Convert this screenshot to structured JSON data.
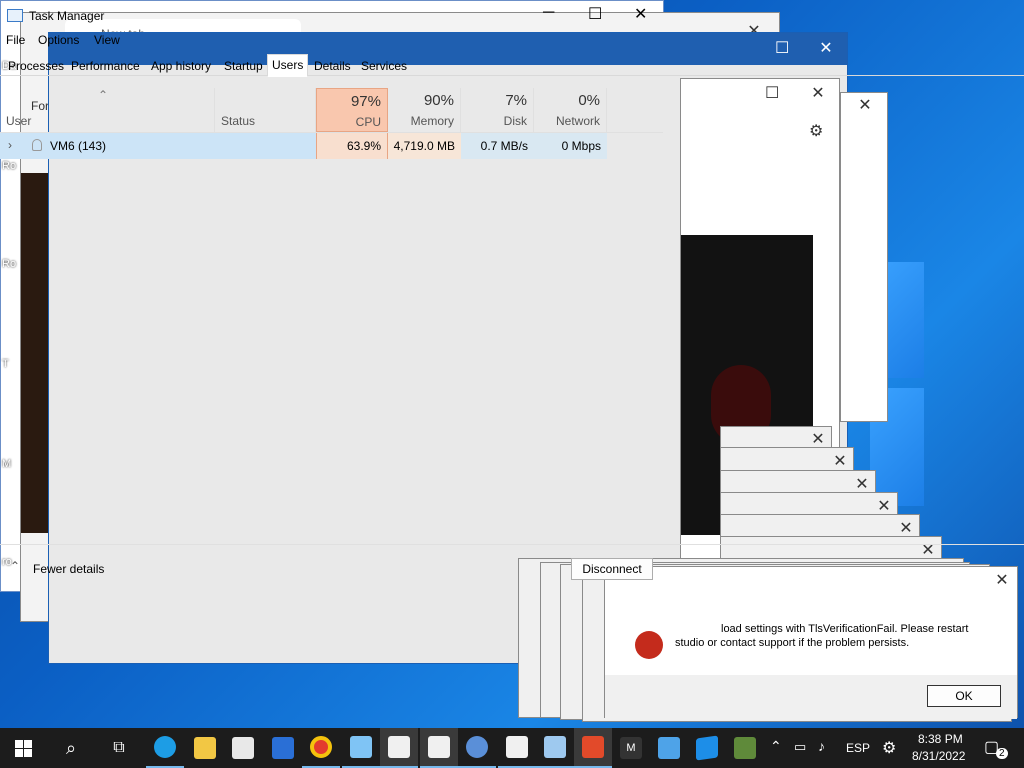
{
  "taskmgr": {
    "title": "Task Manager",
    "menu": [
      "File",
      "Options",
      "View"
    ],
    "tabs": [
      "Processes",
      "Performance",
      "App history",
      "Startup",
      "Users",
      "Details",
      "Services"
    ],
    "columns": {
      "user": "User",
      "status": "Status",
      "cpu": {
        "pct": "97%",
        "name": "CPU"
      },
      "memory": {
        "pct": "90%",
        "name": "Memory"
      },
      "disk": {
        "pct": "7%",
        "name": "Disk"
      },
      "network": {
        "pct": "0%",
        "name": "Network"
      }
    },
    "row": {
      "user": "VM6 (143)",
      "cpu": "63.9%",
      "memory": "4,719.0 MB",
      "disk": "0.7 MB/s",
      "network": "0 Mbps"
    },
    "fewer_details": "Fewer details",
    "disconnect": "Disconnect"
  },
  "dialog": {
    "message_line1": "load settings with TlsVerificationFail. Please restart",
    "message_line2": "studio or contact support if the problem persists.",
    "ok": "OK"
  },
  "background_window": {
    "tab_title": "New tab",
    "addr_partial": "For"
  },
  "desktop": {
    "labels": [
      "Da",
      "Ro",
      "Ro",
      "T",
      "M",
      "ro"
    ]
  },
  "taskbar": {
    "language": "ESP",
    "time": "8:38 PM",
    "date": "8/31/2022",
    "notif_count": "2",
    "m_label": "M"
  },
  "colors": {
    "cpu_header": "#f9c7ae",
    "cpu_cell": "#f8dfcf",
    "mem_cell": "#f7e6d8",
    "selected_row": "#cce4f7",
    "taskbar": "#1c1c1c"
  }
}
